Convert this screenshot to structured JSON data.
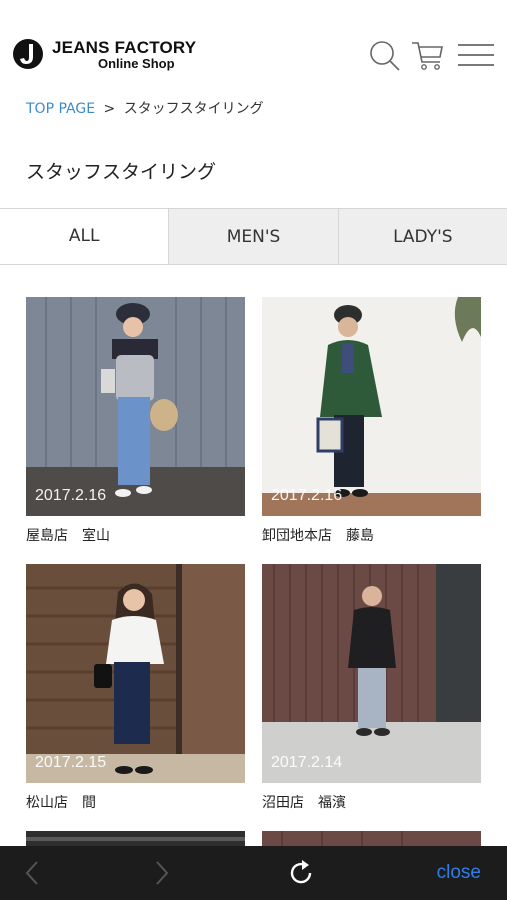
{
  "header": {
    "logo_line1": "JEANS FACTORY",
    "logo_line2": "Online Shop",
    "icons": [
      "search-icon",
      "cart-icon",
      "menu-icon"
    ]
  },
  "breadcrumb": {
    "home": "TOP PAGE",
    "separator": ">",
    "current": "スタッフスタイリング"
  },
  "page_title": "スタッフスタイリング",
  "tabs": [
    {
      "label": "ALL",
      "active": true
    },
    {
      "label": "MEN'S",
      "active": false
    },
    {
      "label": "LADY'S",
      "active": false
    }
  ],
  "cards": [
    {
      "date": "2017.2.16",
      "caption": "屋島店　室山"
    },
    {
      "date": "2017.2.16",
      "caption": "卸団地本店　藤島"
    },
    {
      "date": "2017.2.15",
      "caption": "松山店　間"
    },
    {
      "date": "2017.2.14",
      "caption": "沼田店　福濱"
    }
  ],
  "bottom_bar": {
    "close_label": "close",
    "icons": [
      "back-icon",
      "forward-icon",
      "reload-icon"
    ]
  },
  "colors": {
    "link": "#3d8cc9",
    "close": "#2f7ee8",
    "bar": "#1c1c1c"
  }
}
